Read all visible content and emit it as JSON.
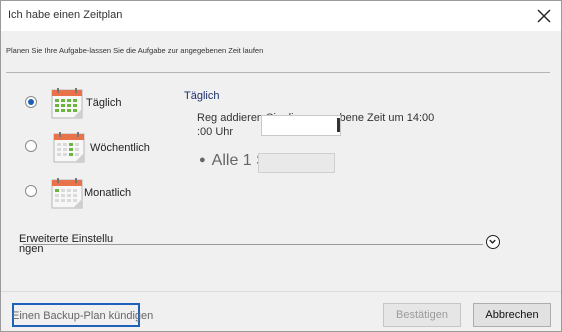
{
  "window": {
    "title": "Ich habe einen Zeitplan"
  },
  "subtitle": "Planen Sie Ihre Aufgabe-lassen Sie die Aufgabe zur angegebenen Zeit laufen",
  "options": [
    {
      "label": "Täglich",
      "selected": true,
      "icon": "calendar-daily-icon",
      "accent": "#6bb640"
    },
    {
      "label": "Wöchentlich",
      "selected": false,
      "icon": "calendar-weekly-icon",
      "accent": "#6bb640"
    },
    {
      "label": "Monatlich",
      "selected": false,
      "icon": "calendar-monthly-icon",
      "accent": "#6bb640"
    }
  ],
  "daily": {
    "heading": "Täglich",
    "description": "Reg addieren Sie die angegebene Zeit um 14:00 :00 Uhr",
    "time_value": "",
    "hourly_label": "Alle 1 Stunde"
  },
  "advanced": {
    "label": "Erweiterte Einstellu ngen"
  },
  "footer": {
    "create_link": "Einen Backup-Plan kündigen",
    "confirm_label": "Bestätigen",
    "cancel_label": "Abbrechen"
  },
  "colors": {
    "accent_blue": "#1f5fb4",
    "heading_blue": "#1d2f6b",
    "calendar_header": "#e8734a",
    "calendar_green": "#6bb640"
  }
}
